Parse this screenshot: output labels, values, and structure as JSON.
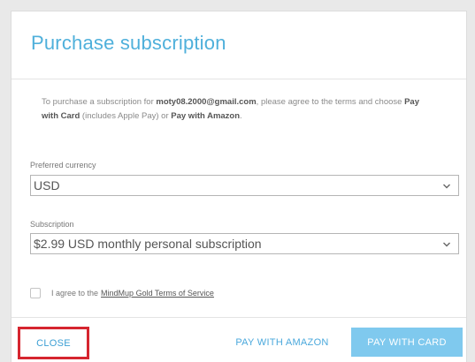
{
  "dialog": {
    "title": "Purchase subscription",
    "intro": {
      "part1": "To purchase a subscription for ",
      "email": "moty08.2000@gmail.com",
      "part2": ", please agree to the terms and choose ",
      "pay_card": "Pay with Card",
      "part3": " (includes Apple Pay) or ",
      "pay_amazon": "Pay with Amazon",
      "part4": "."
    },
    "currency": {
      "label": "Preferred currency",
      "value": "USD"
    },
    "subscription": {
      "label": "Subscription",
      "value": "$2.99 USD monthly personal subscription"
    },
    "agree": {
      "checked": false,
      "text": "I agree to the",
      "link": "MindMup Gold Terms of Service"
    },
    "buttons": {
      "close": "CLOSE",
      "pay_amazon": "PAY WITH AMAZON",
      "pay_card": "PAY WITH CARD"
    }
  },
  "colors": {
    "accent": "#4fb0db",
    "primary_button": "#7fc9ee",
    "highlight_border": "#d6252f"
  },
  "icons": {
    "dropdown": "chevron-down-icon",
    "checkbox": "checkbox-unchecked"
  }
}
